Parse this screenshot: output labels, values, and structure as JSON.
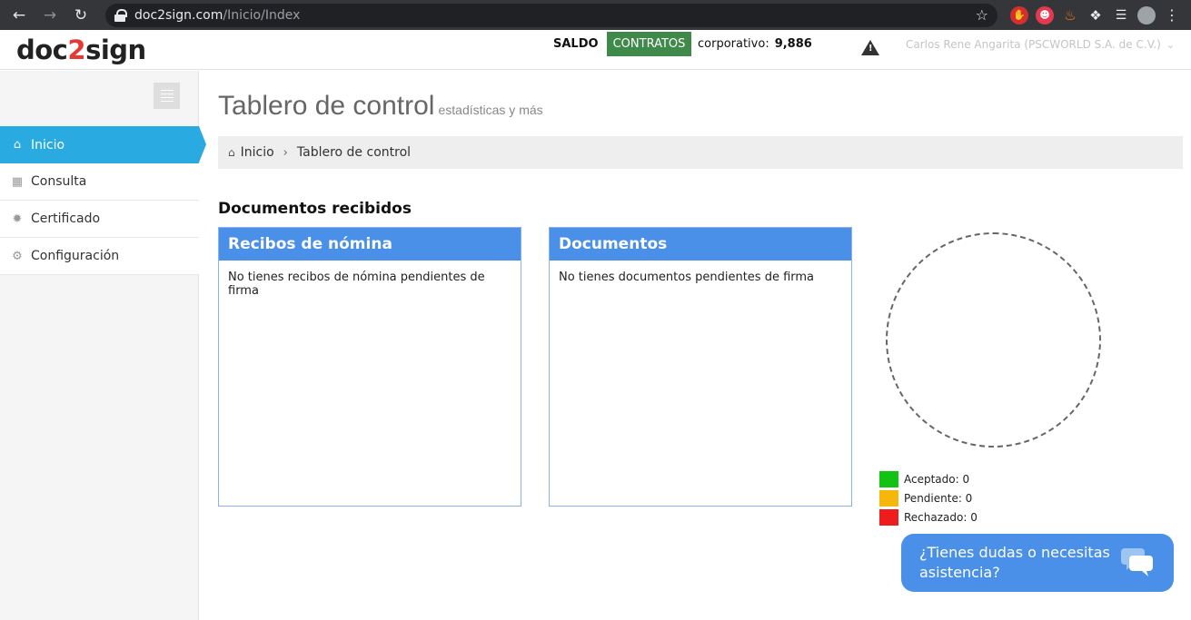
{
  "browser": {
    "url_host": "doc2sign.com",
    "url_path": "/Inicio/Index"
  },
  "header": {
    "logo_a": "doc",
    "logo_b": "2",
    "logo_c": "sign",
    "saldo_label": "SALDO",
    "contratos_label": "CONTRATOS",
    "corp_label": "corporativo:",
    "corp_value": "9,886",
    "user_name": "Carlos Rene Angarita (PSCWORLD S.A. de C.V.)"
  },
  "sidebar": {
    "items": [
      {
        "label": "Inicio",
        "icon": "home-icon",
        "active": true
      },
      {
        "label": "Consulta",
        "icon": "table-icon"
      },
      {
        "label": "Certificado",
        "icon": "cert-icon"
      },
      {
        "label": "Configuración",
        "icon": "gears-icon"
      }
    ]
  },
  "main": {
    "title": "Tablero de control",
    "subtitle": "estadísticas y más",
    "breadcrumb": [
      "Inicio",
      "Tablero de control"
    ],
    "section_title": "Documentos recibidos",
    "panels": [
      {
        "title": "Recibos de nómina",
        "message": "No tienes recibos de nómina pendientes de firma"
      },
      {
        "title": "Documentos",
        "message": "No tienes documentos pendientes de firma"
      }
    ],
    "legend": [
      {
        "label": "Aceptado: 0",
        "color": "#13c313"
      },
      {
        "label": "Pendiente: 0",
        "color": "#f5b70a"
      },
      {
        "label": "Rechazado: 0",
        "color": "#ee1c1c"
      }
    ]
  },
  "help": {
    "text": "¿Tienes dudas o necesitas asistencia?"
  },
  "colors": {
    "accent": "#29abe2",
    "panel_header": "#4a90e8",
    "contratos": "#3f8a4a"
  }
}
